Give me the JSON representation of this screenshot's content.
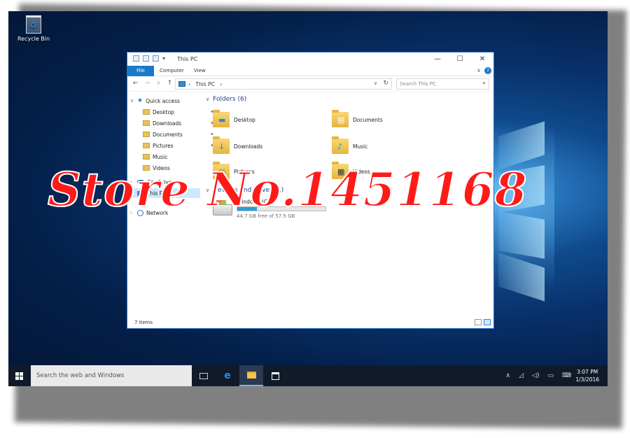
{
  "desktop": {
    "recycle_bin_label": "Recycle Bin",
    "icon": "recycle-bin-icon"
  },
  "explorer": {
    "title": "This PC",
    "window_controls": {
      "minimize": "—",
      "maximize": "☐",
      "close": "✕"
    },
    "ribbon_tabs": [
      "File",
      "Computer",
      "View"
    ],
    "address": {
      "breadcrumb": "This PC",
      "separator": "›"
    },
    "search_placeholder": "Search This PC",
    "nav_pane": {
      "quick_access": "Quick access",
      "items": [
        "Desktop",
        "Downloads",
        "Documents",
        "Pictures",
        "Music",
        "Videos"
      ],
      "onedrive": "OneDrive",
      "this_pc": "This PC",
      "network": "Network"
    },
    "folders_header": "Folders (6)",
    "folders": [
      "Desktop",
      "Documents",
      "Downloads",
      "Music",
      "Pictures",
      "Videos"
    ],
    "devices_header": "Devices and drives (1)",
    "drive": {
      "name": "Windows (C:)",
      "free_text": "44.7 GB free of 57.5 GB",
      "used_fraction": 0.22
    },
    "status_items": "7 items"
  },
  "taskbar": {
    "search_placeholder": "Search the web and Windows",
    "time": "3:07 PM",
    "date": "1/3/2016",
    "tray_icons": [
      "chevron-up-icon",
      "network-icon",
      "volume-icon",
      "notification-icon",
      "keyboard-icon"
    ]
  },
  "watermark": "Store No.1451168",
  "colors": {
    "accent": "#1979ca",
    "taskbar": "#101a29",
    "watermark": "#ff1a1a"
  }
}
